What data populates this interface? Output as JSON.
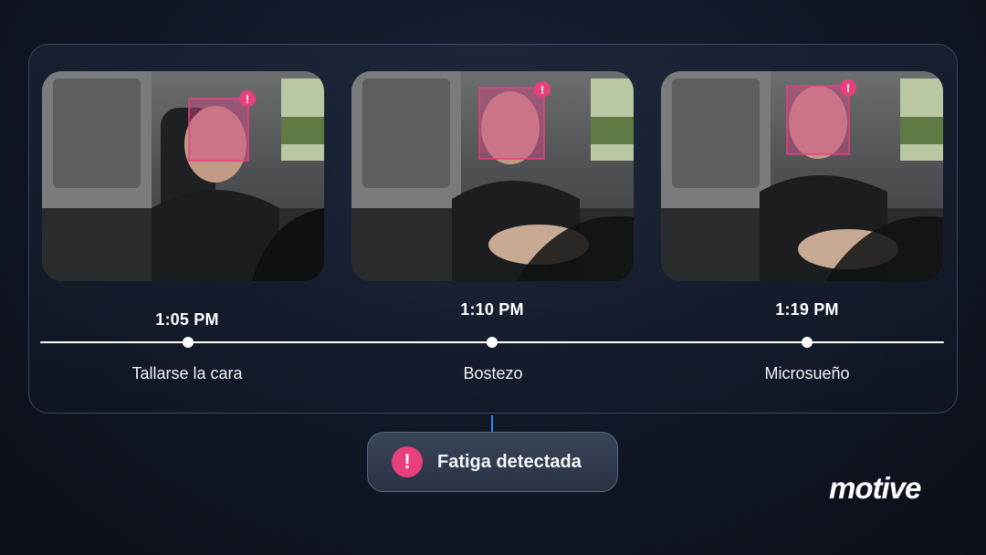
{
  "events": [
    {
      "time": "1:05 PM",
      "label": "Tallarse la cara"
    },
    {
      "time": "1:10 PM",
      "label": "Bostezo"
    },
    {
      "time": "1:19 PM",
      "label": "Microsueño"
    }
  ],
  "alert": {
    "icon": "!",
    "icon_name": "alert-icon",
    "text": "Fatiga detectada"
  },
  "brand": {
    "name": "motive"
  },
  "colors": {
    "accent": "#e8407c",
    "connector": "#3b82f6",
    "panel_border": "#3a4761",
    "background": "#111827"
  },
  "detection_marker": {
    "icon": "!",
    "icon_name": "detection-alert-icon"
  }
}
